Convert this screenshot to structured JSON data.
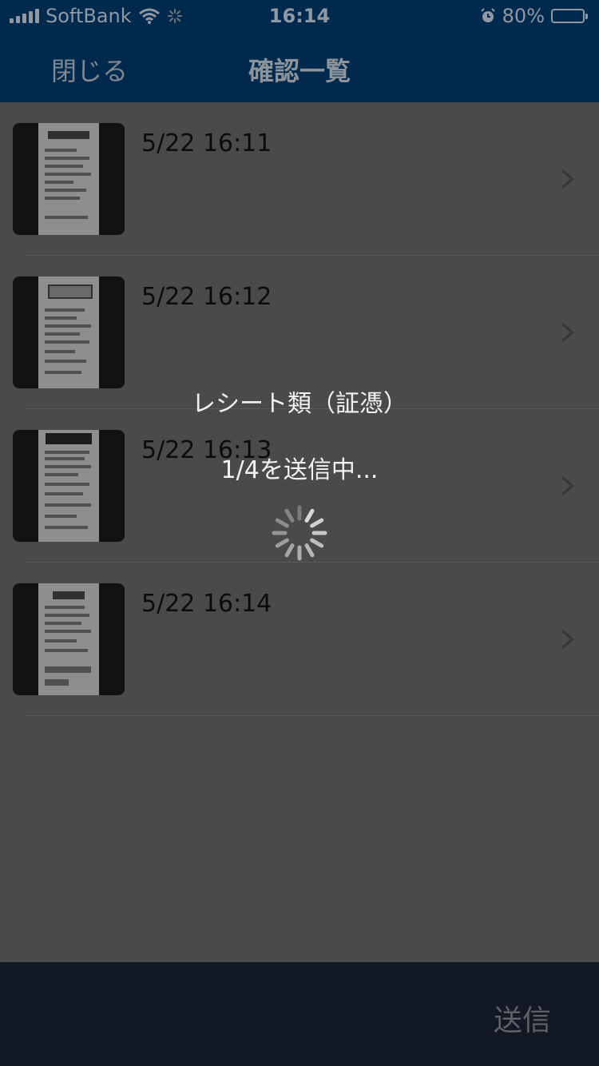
{
  "status_bar": {
    "carrier": "SoftBank",
    "time": "16:14",
    "battery": "80%",
    "battery_level": 0.8,
    "icons": [
      "signal-icon",
      "wifi-icon",
      "loading-icon",
      "alarm-icon",
      "battery-icon"
    ]
  },
  "nav": {
    "close_label": "閉じる",
    "title": "確認一覧"
  },
  "items": [
    {
      "time": "5/22 16:11"
    },
    {
      "time": "5/22 16:12"
    },
    {
      "time": "5/22 16:13"
    },
    {
      "time": "5/22 16:14"
    }
  ],
  "hud": {
    "title": "レシート類（証憑）",
    "message": "1/4を送信中..."
  },
  "toolbar": {
    "send_label": "送信"
  },
  "colors": {
    "nav_bar": "#002a4d",
    "overlay_bg": "#4a4a4a",
    "toolbar": "#131924"
  }
}
